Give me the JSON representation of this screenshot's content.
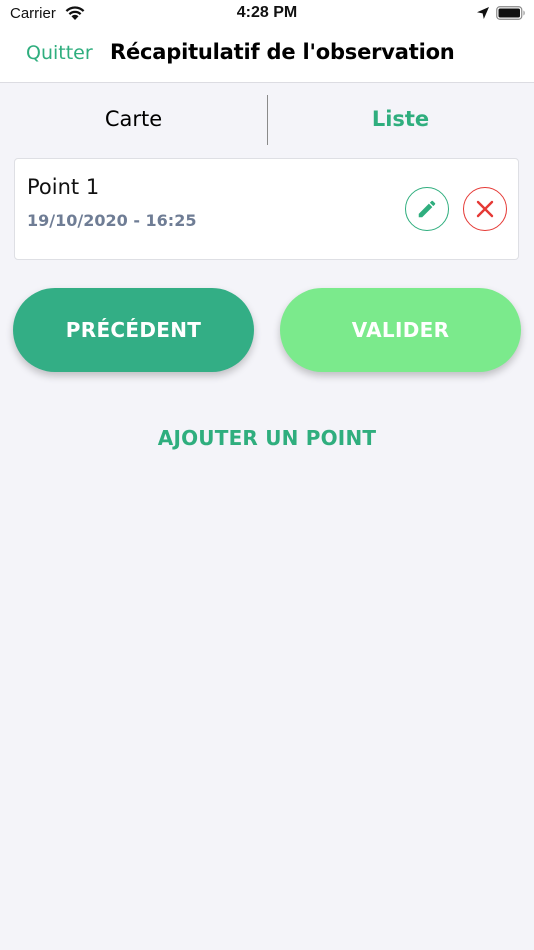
{
  "status_bar": {
    "carrier": "Carrier",
    "time": "4:28 PM",
    "icons": [
      "wifi-icon",
      "location-icon",
      "battery-icon"
    ]
  },
  "header": {
    "quit_label": "Quitter",
    "title": "Récapitulatif de l'observation"
  },
  "tabs": [
    {
      "label": "Carte",
      "active": false
    },
    {
      "label": "Liste",
      "active": true
    }
  ],
  "points": [
    {
      "name": "Point 1",
      "date": "19/10/2020 - 16:25",
      "actions": [
        "pencil-icon",
        "close-icon"
      ]
    }
  ],
  "actions": {
    "previous_label": "PRÉCÉDENT",
    "validate_label": "VALIDER",
    "add_point_label": "AJOUTER UN POINT"
  },
  "colors": {
    "accent": "#2fae7e",
    "previous_button": "#33ae85",
    "validate_button": "#7bea8c",
    "delete": "#e53935",
    "date_text": "#6f7d95",
    "background": "#f4f4f9"
  }
}
